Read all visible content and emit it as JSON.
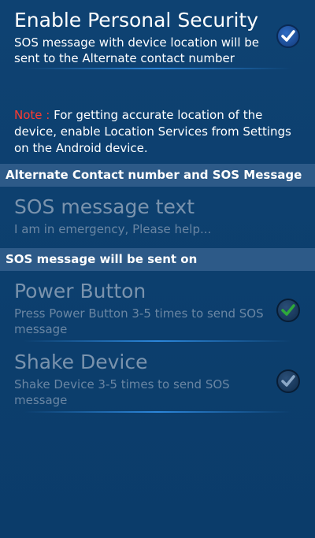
{
  "personal_security": {
    "title": "Enable Personal Security",
    "summary": "SOS message with device location will be sent to the Alternate contact number",
    "checked": true
  },
  "note": {
    "label": "Note : ",
    "text": "For getting accurate location of the device, enable Location Services from Settings on the Android device."
  },
  "section_contact": {
    "header": "Alternate Contact number and SOS Message"
  },
  "sos_message": {
    "title": "SOS message text",
    "summary": "I am in emergency, Please help..."
  },
  "section_sent_on": {
    "header": "SOS message will be sent on"
  },
  "power_button": {
    "title": "Power Button",
    "summary": "Press Power Button 3-5 times to send SOS message",
    "checked": true,
    "check_color": "#2ea83a"
  },
  "shake_device": {
    "title": "Shake Device",
    "summary": "Shake Device 3-5 times to send SOS message",
    "checked": true,
    "check_color": "#8aa7c6"
  },
  "icons": {
    "checkbox": "checkmark-icon"
  }
}
